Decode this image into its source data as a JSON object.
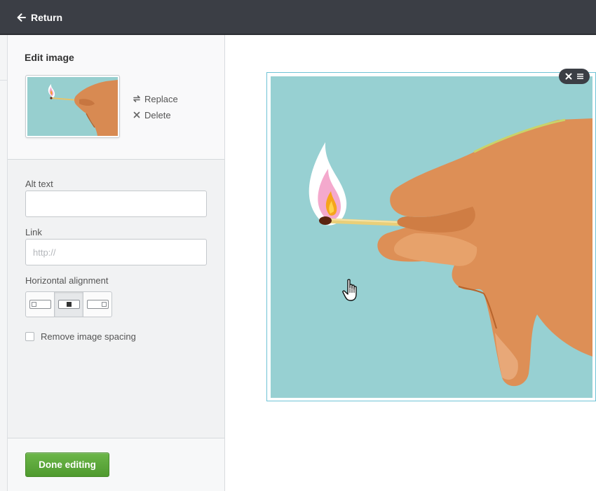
{
  "topbar": {
    "return_label": "Return",
    "return_icon": "arrow-left-icon"
  },
  "sidebar": {
    "title": "Edit image",
    "image_actions": {
      "replace_label": "Replace",
      "replace_icon": "swap-icon",
      "delete_label": "Delete",
      "delete_icon": "close-icon"
    },
    "alt_text": {
      "label": "Alt text",
      "value": "",
      "placeholder": ""
    },
    "link": {
      "label": "Link",
      "value": "",
      "placeholder": "http://"
    },
    "alignment": {
      "label": "Horizontal alignment",
      "options": [
        "left",
        "center",
        "right"
      ],
      "selected": "center"
    },
    "spacing": {
      "label": "Remove image spacing",
      "checked": false
    },
    "done_label": "Done editing"
  },
  "canvas": {
    "toolbar_icons": [
      "close-icon",
      "menu-icon"
    ]
  },
  "colors": {
    "topbar": "#3b3e45",
    "accent_green": "#5aa53a",
    "selection_outline": "#6fc3d6",
    "image_background": "#97d0d2"
  }
}
